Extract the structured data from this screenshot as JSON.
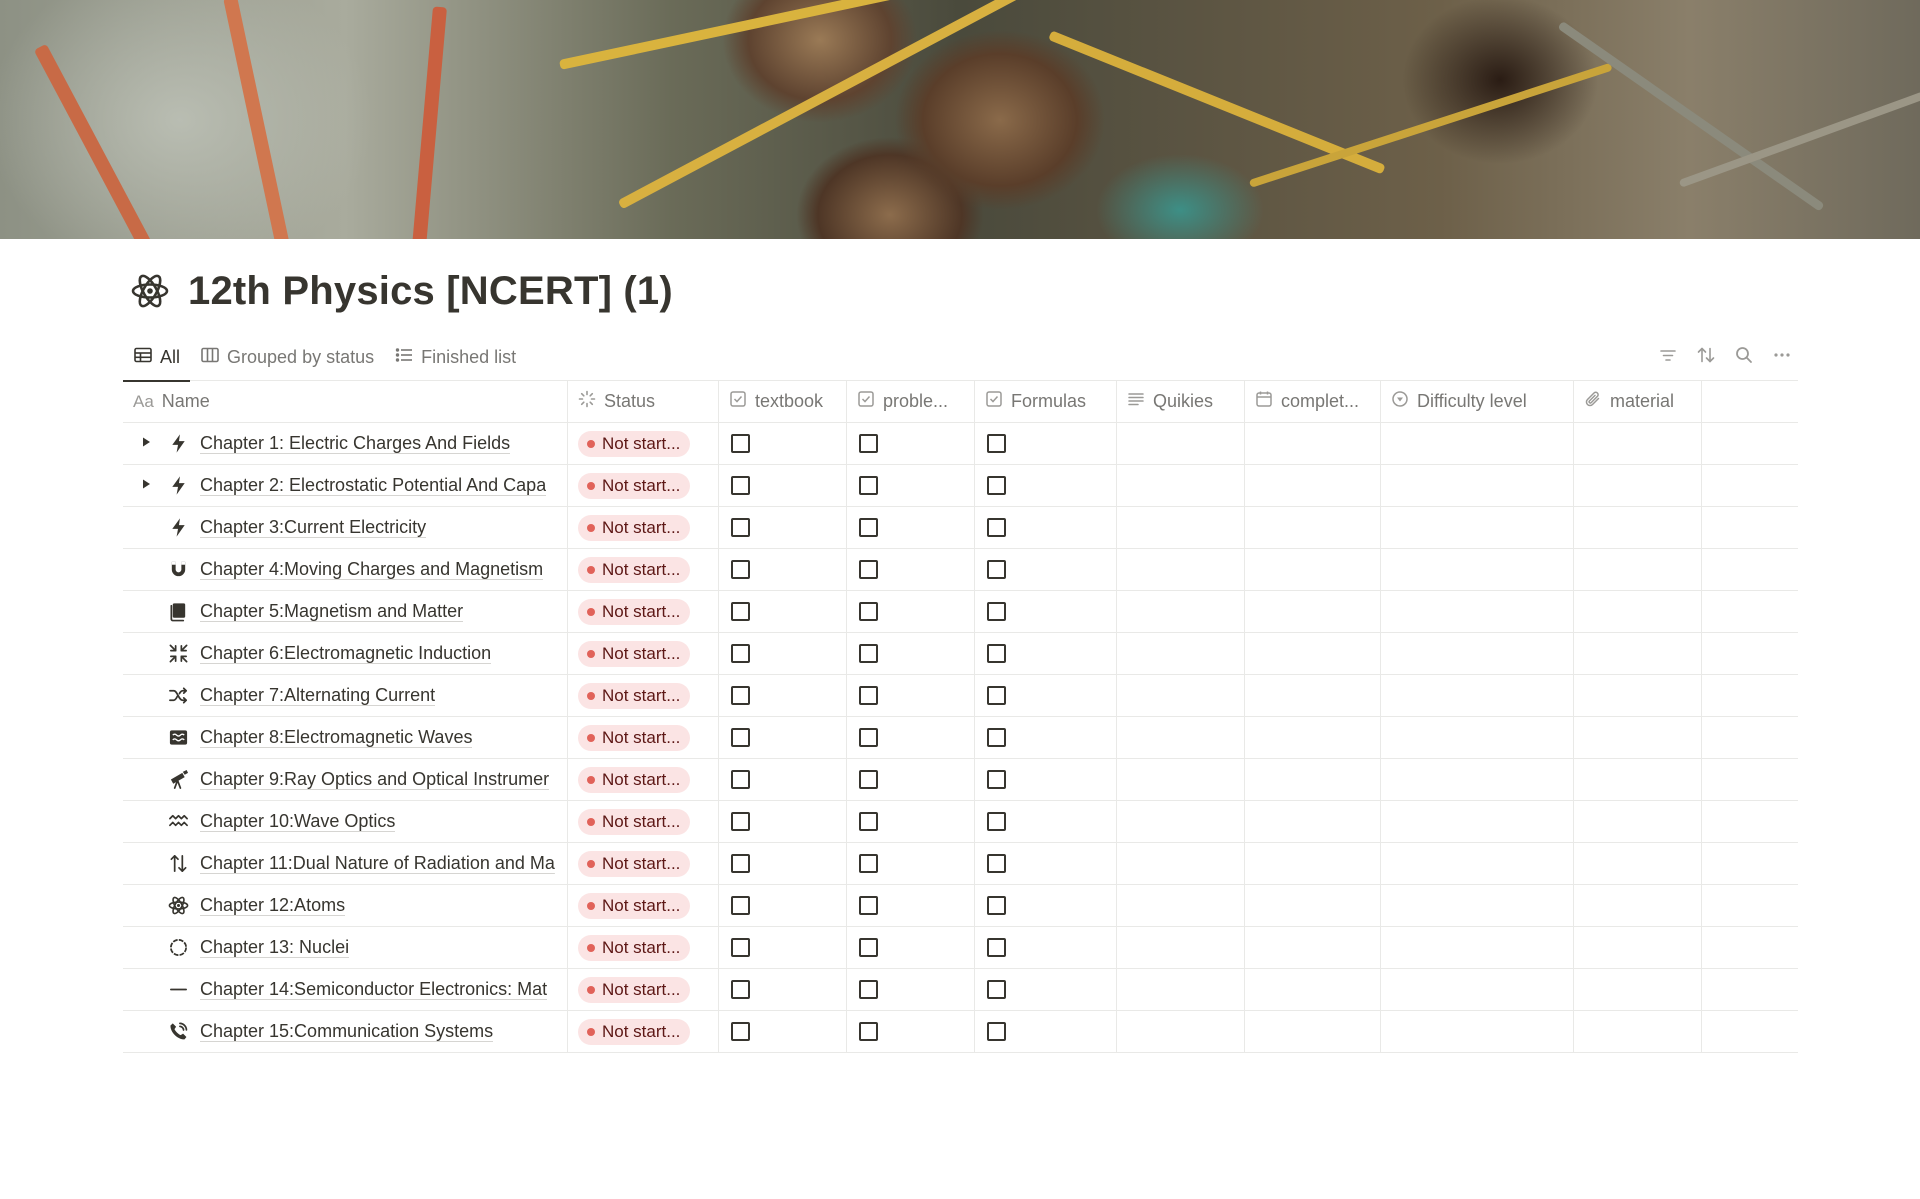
{
  "page": {
    "title": "12th Physics [NCERT] (1)",
    "icon": "atom-icon"
  },
  "views": [
    {
      "label": "All",
      "icon": "table-icon",
      "active": true
    },
    {
      "label": "Grouped by status",
      "icon": "board-icon",
      "active": false
    },
    {
      "label": "Finished list",
      "icon": "list-icon",
      "active": false
    }
  ],
  "toolbar": {
    "filter": "filter-icon",
    "sort": "sort-icon",
    "search": "search-icon",
    "more": "more-icon"
  },
  "columns": {
    "name": "Name",
    "status": "Status",
    "textbook": "textbook",
    "problem": "proble...",
    "formulas": "Formulas",
    "quikies": "Quikies",
    "complete": "complet...",
    "difficulty": "Difficulty level",
    "material": "material"
  },
  "rows": [
    {
      "name": "Chapter 1: Electric Charges And Fields",
      "icon": "lightning-icon",
      "expandable": true,
      "status": "Not start..."
    },
    {
      "name": "Chapter 2: Electrostatic Potential And Capa",
      "icon": "lightning-icon",
      "expandable": true,
      "status": "Not start..."
    },
    {
      "name": "Chapter 3:Current Electricity",
      "icon": "lightning-icon",
      "expandable": false,
      "status": "Not start..."
    },
    {
      "name": "Chapter 4:Moving Charges and Magnetism",
      "icon": "magnet-icon",
      "expandable": false,
      "status": "Not start..."
    },
    {
      "name": "Chapter 5:Magnetism and Matter",
      "icon": "book-icon",
      "expandable": false,
      "status": "Not start..."
    },
    {
      "name": "Chapter 6:Electromagnetic Induction",
      "icon": "arrows-in-icon",
      "expandable": false,
      "status": "Not start..."
    },
    {
      "name": "Chapter 7:Alternating Current",
      "icon": "shuffle-icon",
      "expandable": false,
      "status": "Not start..."
    },
    {
      "name": "Chapter 8:Electromagnetic Waves",
      "icon": "waves-box-icon",
      "expandable": false,
      "status": "Not start..."
    },
    {
      "name": "Chapter 9:Ray Optics and Optical Instrumer",
      "icon": "telescope-icon",
      "expandable": false,
      "status": "Not start..."
    },
    {
      "name": "Chapter 10:Wave Optics",
      "icon": "wave-icon",
      "expandable": false,
      "status": "Not start..."
    },
    {
      "name": "Chapter 11:Dual Nature of Radiation and Ma",
      "icon": "arrows-up-down-icon",
      "expandable": false,
      "status": "Not start..."
    },
    {
      "name": "Chapter 12:Atoms",
      "icon": "atom-icon",
      "expandable": false,
      "status": "Not start..."
    },
    {
      "name": "Chapter 13: Nuclei",
      "icon": "circle-icon",
      "expandable": false,
      "status": "Not start..."
    },
    {
      "name": "Chapter 14:Semiconductor Electronics: Mat",
      "icon": "minus-icon",
      "expandable": false,
      "status": "Not start..."
    },
    {
      "name": "Chapter 15:Communication Systems",
      "icon": "phone-icon",
      "expandable": false,
      "status": "Not start..."
    }
  ],
  "colors": {
    "status_pill_bg": "#fbe4e4",
    "status_dot": "#e16259",
    "text": "#37352f",
    "muted": "#787774"
  }
}
